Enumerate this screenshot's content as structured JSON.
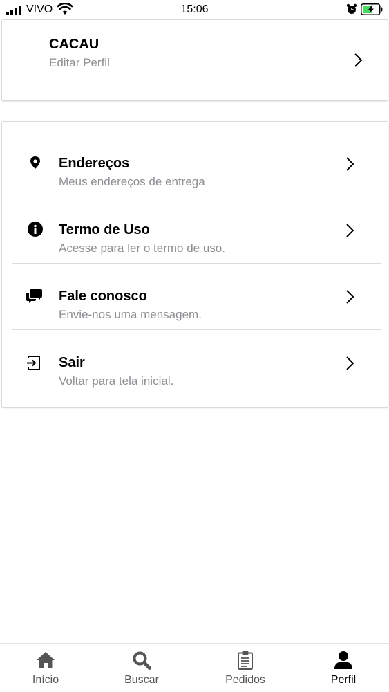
{
  "status_bar": {
    "carrier": "VIVO",
    "time": "15:06"
  },
  "profile": {
    "name": "CACAU",
    "subtitle": "Editar Perfil"
  },
  "menu": {
    "items": [
      {
        "title": "Endereços",
        "subtitle": "Meus endereços de entrega",
        "icon": "location-pin-icon"
      },
      {
        "title": "Termo de Uso",
        "subtitle": "Acesse para ler o termo de uso.",
        "icon": "info-icon"
      },
      {
        "title": "Fale conosco",
        "subtitle": "Envie-nos uma mensagem.",
        "icon": "chat-icon"
      },
      {
        "title": "Sair",
        "subtitle": "Voltar para tela inicial.",
        "icon": "exit-icon"
      }
    ]
  },
  "tab_bar": {
    "tabs": [
      {
        "label": "Início",
        "icon": "home-icon",
        "active": false
      },
      {
        "label": "Buscar",
        "icon": "search-icon",
        "active": false
      },
      {
        "label": "Pedidos",
        "icon": "clipboard-icon",
        "active": false
      },
      {
        "label": "Perfil",
        "icon": "user-icon",
        "active": true
      }
    ]
  },
  "colors": {
    "text": "#000000",
    "secondary_text": "#8e8e93",
    "tab_inactive": "#555555",
    "battery_fill": "#4cd964"
  }
}
